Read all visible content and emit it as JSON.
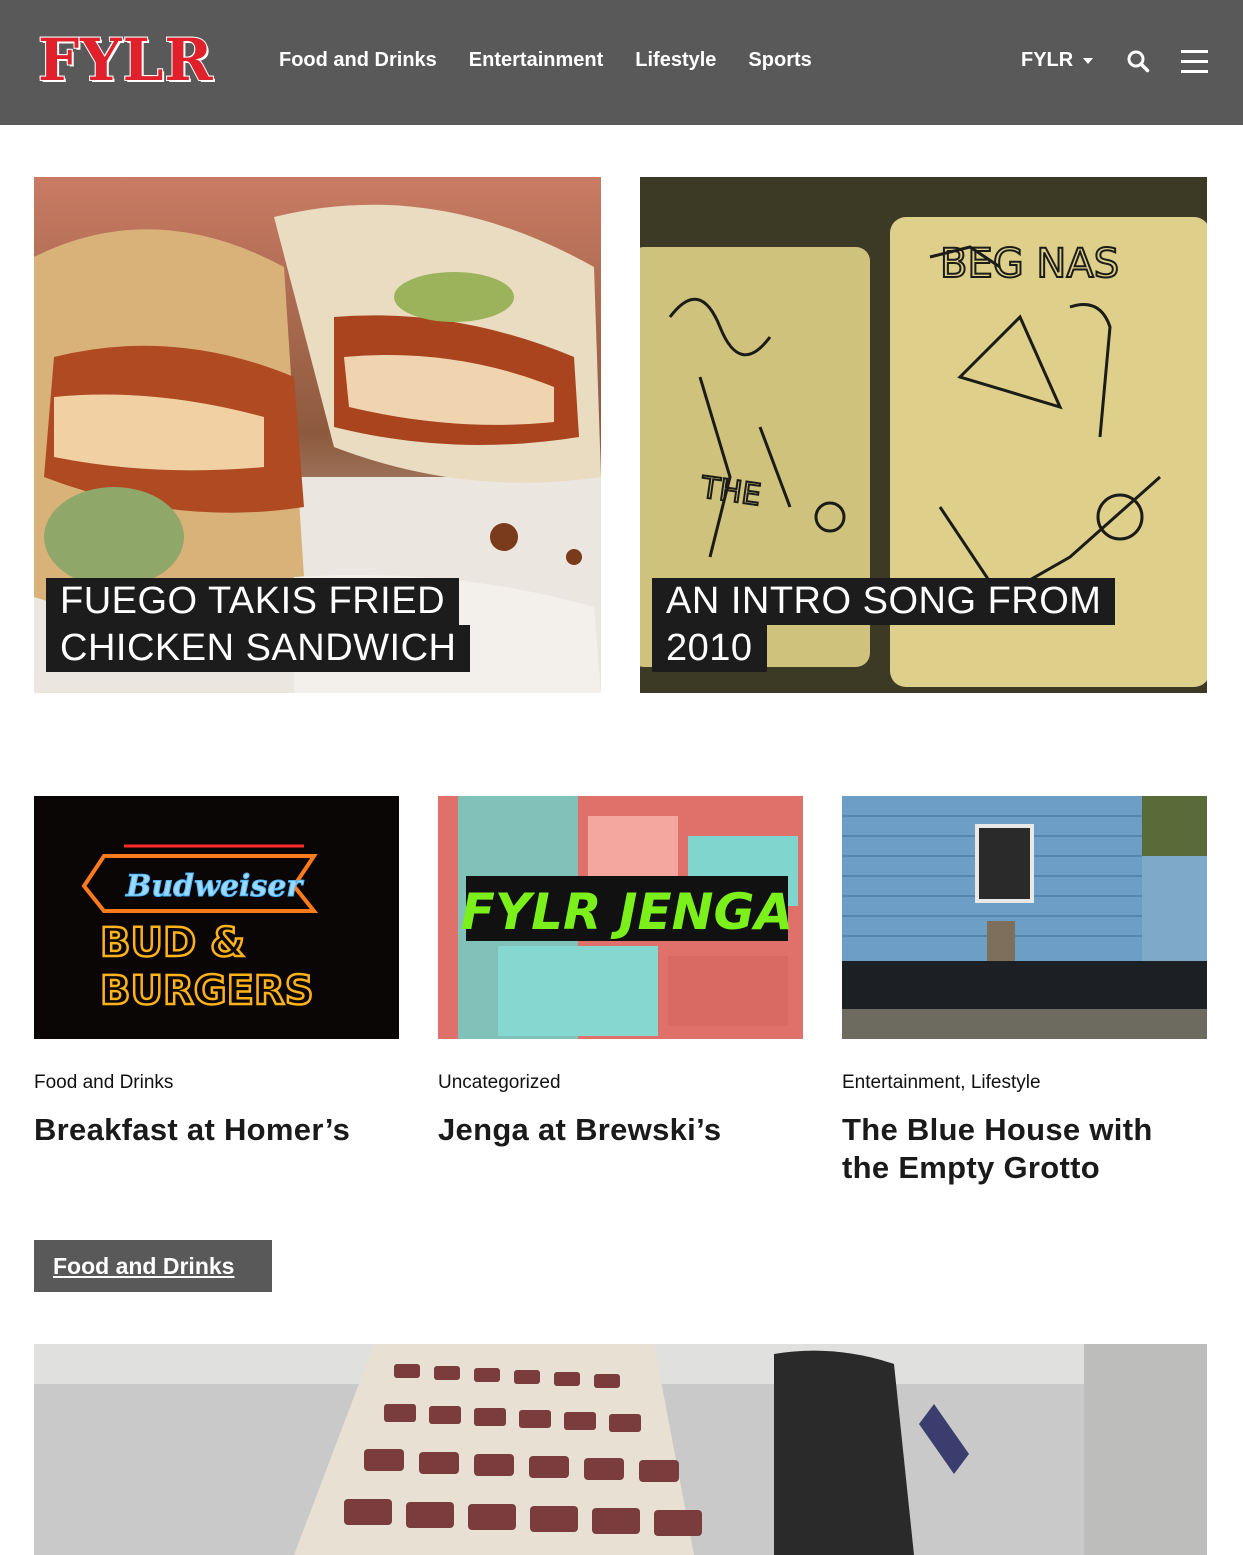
{
  "header": {
    "logo": "FYLR",
    "nav": [
      "Food and Drinks",
      "Entertainment",
      "Lifestyle",
      "Sports"
    ],
    "site_switch": "FYLR",
    "icons": {
      "search": "search-icon",
      "menu": "hamburger-menu-icon",
      "dropdown": "caret-down-icon"
    }
  },
  "featured": [
    {
      "title_lines": [
        "FUEGO TAKIS FRIED",
        "CHICKEN SANDWICH"
      ],
      "image": "chicken-sandwich-photo"
    },
    {
      "title_lines": [
        "AN INTRO SONG FROM",
        "2010"
      ],
      "image": "sketch-cards-photo"
    }
  ],
  "cards": [
    {
      "category": "Food and Drinks",
      "title": "Breakfast at Homer’s",
      "image": "neon-sign-photo",
      "sign": {
        "brand": "Budweiser",
        "line1": "BUD & ",
        "line2": "BURGERS"
      }
    },
    {
      "category": "Uncategorized",
      "title": "Jenga at Brewski’s",
      "image": "jenga-photo",
      "overlay": "FYLR JENGA"
    },
    {
      "category": "Entertainment, Lifestyle",
      "title": "The Blue House with the Empty Grotto",
      "image": "blue-house-photo"
    }
  ],
  "section": {
    "label": "Food and Drinks"
  },
  "colors": {
    "header_bg": "#595959",
    "logo_red": "#e0202b",
    "title_bg": "#1c1c1c",
    "jenga_green": "#7cf01b"
  }
}
